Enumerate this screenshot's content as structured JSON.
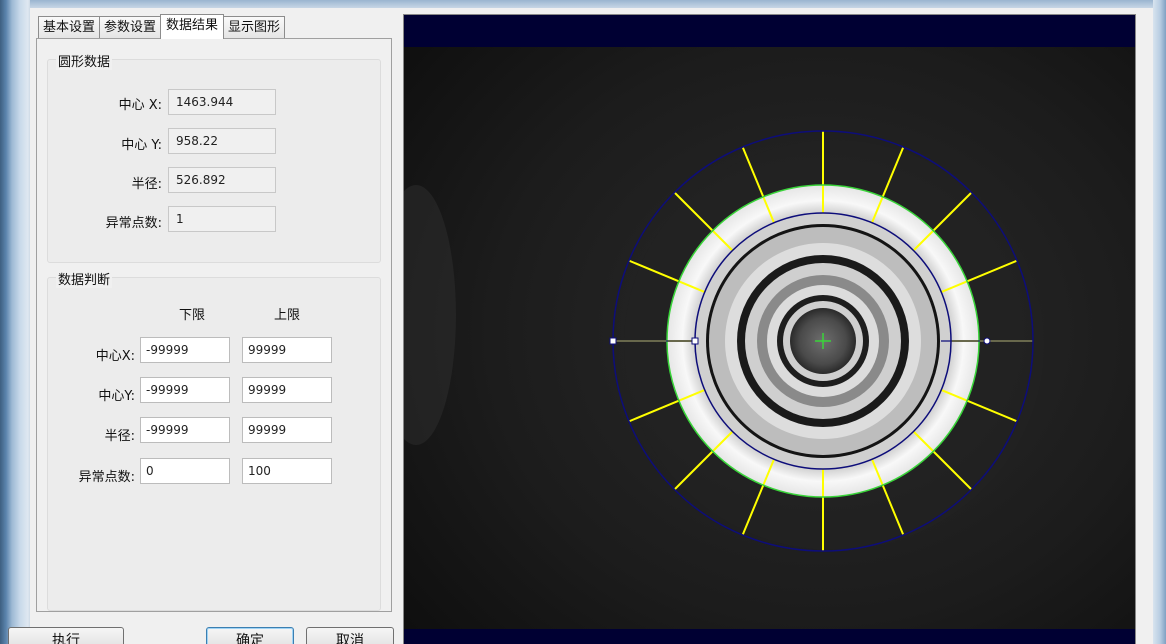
{
  "tabs": [
    {
      "label": "基本设置"
    },
    {
      "label": "参数设置"
    },
    {
      "label": "数据结果"
    },
    {
      "label": "显示图形"
    }
  ],
  "shape_data": {
    "title": "圆形数据",
    "center_x_label": "中心 X:",
    "center_x_value": "1463.944",
    "center_y_label": "中心 Y:",
    "center_y_value": "958.22",
    "radius_label": "半径:",
    "radius_value": "526.892",
    "anomaly_label": "异常点数:",
    "anomaly_value": "1"
  },
  "judgment": {
    "title": "数据判断",
    "lower_header": "下限",
    "upper_header": "上限",
    "rows": [
      {
        "label": "中心X:",
        "lower": "-99999",
        "upper": "99999"
      },
      {
        "label": "中心Y:",
        "lower": "-99999",
        "upper": "99999"
      },
      {
        "label": "半径:",
        "lower": "-99999",
        "upper": "99999"
      },
      {
        "label": "异常点数:",
        "lower": "0",
        "upper": "100"
      }
    ]
  },
  "buttons": {
    "execute": "执行",
    "ok": "确定",
    "cancel": "取消"
  },
  "colors": {
    "caliper_yellow": "#ffff00",
    "ring_blue": "#0d0d7a",
    "fit_green": "#39d439",
    "viewer_band": "#000033"
  }
}
